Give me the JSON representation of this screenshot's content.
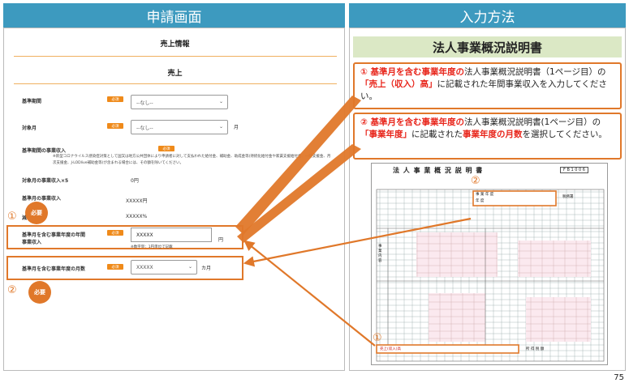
{
  "left": {
    "header": "申請画面",
    "section_title": "売上情報",
    "subsection_title": "売上",
    "badge": "必須",
    "hissu_circle": "必要",
    "yen": "円",
    "kagetsu": "カ月",
    "fields": {
      "kijun_kikan": {
        "label": "基準期間",
        "value": "--なし--"
      },
      "taisho_tsuki": {
        "label": "対象月",
        "value": "--なし--",
        "suffix": "月"
      },
      "kijun_shunyu": {
        "label": "基準期間の事業収入",
        "note": "※新型コロナウイルス感染症対策として国又は地方公共団体により申請者に対して支払われた給付金、補助金、助成金等(持続化給付金や家賃支援給付金、一時支援金、月次支援金、J-LODlive補助金等)が含まれる場合には、その額を除いてください。"
      },
      "taisho_x5": {
        "label": "対象月の事業収入×5",
        "value": "0円"
      },
      "kijun_tsuki_shunyu": {
        "label": "基準月の事業収入",
        "value": "XXXXX円"
      },
      "ratio": {
        "label": "減",
        "value": "XXXXX%"
      },
      "nenkan": {
        "label_line1": "基準月を含む事業年度の年間",
        "label_line2": "事業収入",
        "value": "XXXXX",
        "note": "※数字単：1円単位で記載"
      },
      "tsukisu": {
        "label": "基準月を含む事業年度の月数",
        "value": "XXXXX"
      }
    },
    "markers": [
      "①",
      "②"
    ]
  },
  "right": {
    "header": "入力方法",
    "doc_title": "法人事業概況説明書",
    "instruction_1": {
      "num": "① ",
      "p1": "基準月を含む事業年度の",
      "p2": "法人事業概況説明書（1ページ目）の",
      "p3": "「売上（収入）高」",
      "p4": "に記載された年間事業収入を入力してください。"
    },
    "instruction_2": {
      "num": "② ",
      "p1": "基準月を含む事業年度の",
      "p2": "法人事業概況説明書(1ページ目）の",
      "p3": "「事業年度」",
      "p4": "に記載された",
      "p5": "事業年度の月数",
      "p6": "を選択してください。"
    },
    "form": {
      "title": "法 人 事 業 概 況 説 明 書",
      "code": "F B 1 0 0 6",
      "jigyo_nendo_1": "事 業 年 度",
      "jigyo_nendo_2": "年 度",
      "seiri": "税務署",
      "uriage": "売上(収入)高",
      "shoyu": "所 得 税 額",
      "side_label": "事 業 内 容",
      "markers": [
        "②",
        "①"
      ]
    }
  },
  "page_number": "75",
  "colors": {
    "header": "#3d9abf",
    "accent": "#e0782a",
    "red": "#e8251b",
    "doc_title_bg": "#dbe8c5"
  }
}
